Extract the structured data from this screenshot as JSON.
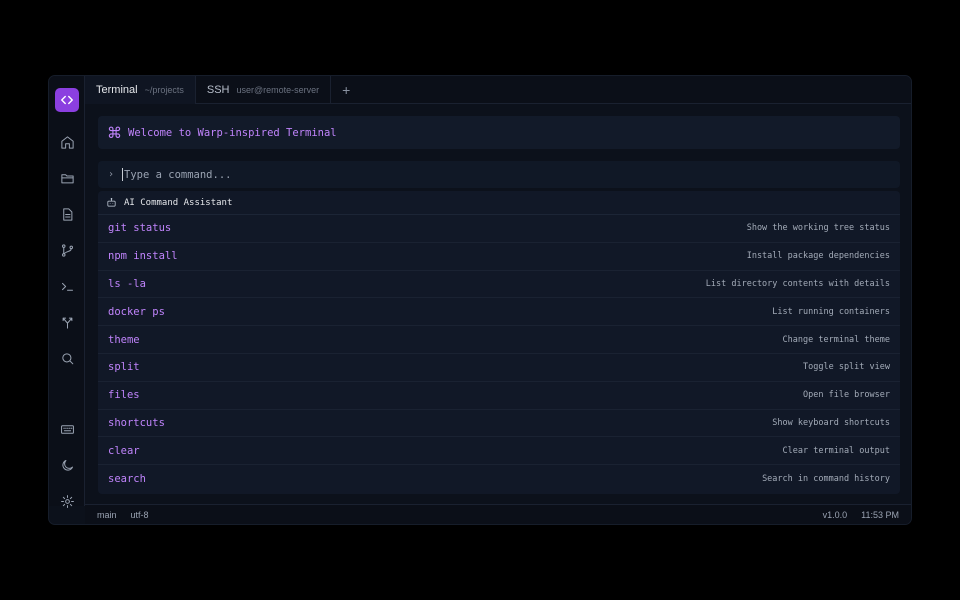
{
  "sidebar": {
    "logo_icon": "code-brackets-icon",
    "accent": "#8b3fe0",
    "nav": [
      {
        "name": "home",
        "icon": "home-icon"
      },
      {
        "name": "folder",
        "icon": "folder-icon"
      },
      {
        "name": "file",
        "icon": "file-icon"
      },
      {
        "name": "git",
        "icon": "git-branch-icon"
      },
      {
        "name": "terminal",
        "icon": "terminal-icon"
      },
      {
        "name": "fork",
        "icon": "fork-icon"
      },
      {
        "name": "search",
        "icon": "search-icon"
      }
    ],
    "bottom": [
      {
        "name": "keyboard",
        "icon": "keyboard-icon"
      },
      {
        "name": "theme",
        "icon": "moon-icon"
      },
      {
        "name": "settings",
        "icon": "gear-icon"
      }
    ]
  },
  "tabs": [
    {
      "title": "Terminal",
      "subtitle": "~/projects",
      "active": true
    },
    {
      "title": "SSH",
      "subtitle": "user@remote-server",
      "active": false
    }
  ],
  "tab_add": "+",
  "welcome": {
    "icon": "⌘",
    "text": "Welcome to Warp-inspired Terminal"
  },
  "command_input": {
    "prompt": ">",
    "placeholder": "Type a command...",
    "value": ""
  },
  "assistant": {
    "title": "AI Command Assistant",
    "icon": "robot-icon",
    "commands": [
      {
        "name": "git status",
        "desc": "Show the working tree status"
      },
      {
        "name": "npm install",
        "desc": "Install package dependencies"
      },
      {
        "name": "ls -la",
        "desc": "List directory contents with details"
      },
      {
        "name": "docker ps",
        "desc": "List running containers"
      },
      {
        "name": "theme",
        "desc": "Change terminal theme"
      },
      {
        "name": "split",
        "desc": "Toggle split view"
      },
      {
        "name": "files",
        "desc": "Open file browser"
      },
      {
        "name": "shortcuts",
        "desc": "Show keyboard shortcuts"
      },
      {
        "name": "clear",
        "desc": "Clear terminal output"
      },
      {
        "name": "search",
        "desc": "Search in command history"
      }
    ]
  },
  "status": {
    "branch": "main",
    "encoding": "utf-8",
    "version": "v1.0.0",
    "time": "11:53 PM"
  },
  "colors": {
    "command": "#c084fc",
    "background": "#0c111b",
    "panel": "#111827"
  }
}
